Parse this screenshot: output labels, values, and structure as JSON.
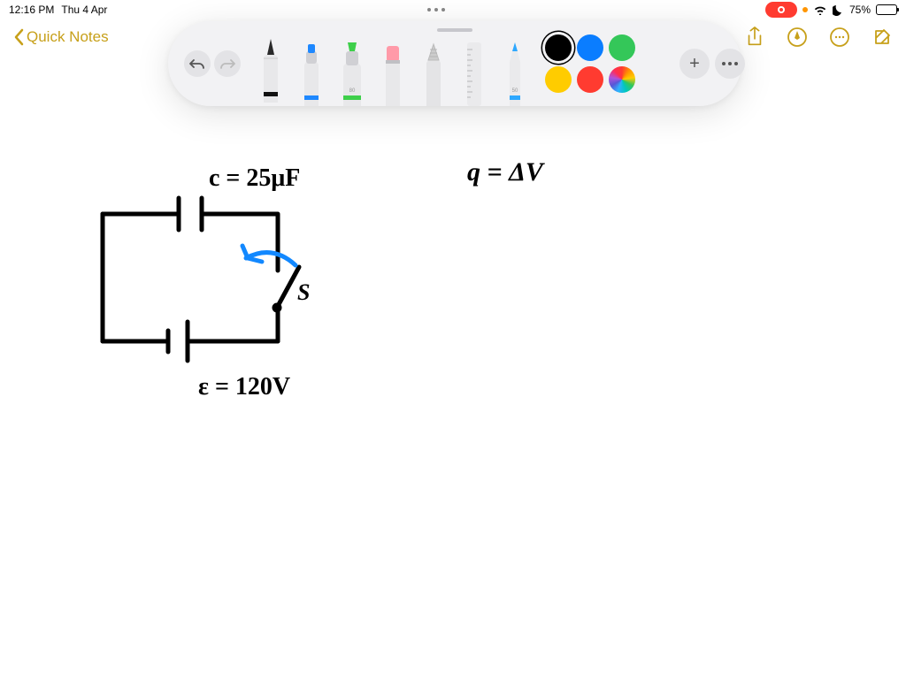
{
  "status": {
    "time": "12:16 PM",
    "date": "Thu 4 Apr",
    "battery_percent": "75%"
  },
  "nav": {
    "back_label": "Quick Notes"
  },
  "toolbar": {
    "tools": [
      {
        "name": "pen"
      },
      {
        "name": "marker"
      },
      {
        "name": "highlighter"
      },
      {
        "name": "eraser"
      },
      {
        "name": "lasso"
      },
      {
        "name": "ruler"
      },
      {
        "name": "pencil"
      }
    ],
    "colors": {
      "row1": [
        "#000000",
        "#0a7dff",
        "#34c759",
        "#ffffff00"
      ],
      "row2": [
        "#ffcc00",
        "#ff3b30",
        "multicolor",
        "#ffffff00"
      ],
      "selected_index": 0
    }
  },
  "handwriting": {
    "eq1": "c = 25μF",
    "eq2": "q = ΔV",
    "switch_label": "S",
    "eq3": "ε = 120V"
  }
}
